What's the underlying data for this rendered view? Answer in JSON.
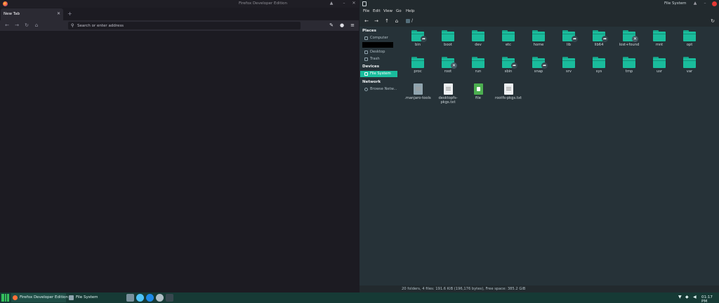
{
  "firefox": {
    "title": "Firefox Developer Edition",
    "tab_label": "New Tab",
    "new_tab_glyph": "+",
    "url_placeholder": "Search or enter address",
    "icons": [
      "back-icon",
      "forward-icon",
      "reload-icon",
      "home-icon",
      "search-icon",
      "wrench-icon",
      "account-icon",
      "menu-icon"
    ],
    "accent": "#ff7139"
  },
  "filemanager": {
    "title": "File System",
    "menu": [
      "File",
      "Edit",
      "View",
      "Go",
      "Help"
    ],
    "location": "/",
    "sidebar": {
      "places_heading": "Places",
      "places": [
        "Computer",
        "Desktop",
        "Trash"
      ],
      "devices_heading": "Devices",
      "devices": [
        "File System"
      ],
      "network_heading": "Network",
      "network": [
        "Browse Netw..."
      ]
    },
    "items": [
      {
        "name": "bin",
        "type": "folder",
        "emblem": "link"
      },
      {
        "name": "boot",
        "type": "folder",
        "emblem": ""
      },
      {
        "name": "dev",
        "type": "folder",
        "emblem": ""
      },
      {
        "name": "etc",
        "type": "folder",
        "emblem": ""
      },
      {
        "name": "home",
        "type": "folder",
        "emblem": ""
      },
      {
        "name": "lib",
        "type": "folder",
        "emblem": "link"
      },
      {
        "name": "lib64",
        "type": "folder",
        "emblem": "link"
      },
      {
        "name": "lost+found",
        "type": "folder",
        "emblem": "locked"
      },
      {
        "name": "mnt",
        "type": "folder",
        "emblem": ""
      },
      {
        "name": "opt",
        "type": "folder",
        "emblem": ""
      },
      {
        "name": "proc",
        "type": "folder",
        "emblem": ""
      },
      {
        "name": "root",
        "type": "folder",
        "emblem": "locked"
      },
      {
        "name": "run",
        "type": "folder",
        "emblem": ""
      },
      {
        "name": "sbin",
        "type": "folder",
        "emblem": "link"
      },
      {
        "name": "snap",
        "type": "folder",
        "emblem": "link"
      },
      {
        "name": "srv",
        "type": "folder",
        "emblem": ""
      },
      {
        "name": "sys",
        "type": "folder",
        "emblem": ""
      },
      {
        "name": "tmp",
        "type": "folder",
        "emblem": ""
      },
      {
        "name": "usr",
        "type": "folder",
        "emblem": ""
      },
      {
        "name": "var",
        "type": "folder",
        "emblem": ""
      },
      {
        "name": ".manjaro-tools",
        "type": "file-gray",
        "emblem": ""
      },
      {
        "name": "desktopfs-pkgs.txt",
        "type": "file-text",
        "emblem": ""
      },
      {
        "name": "file",
        "type": "file-green",
        "emblem": ""
      },
      {
        "name": "rootfs-pkgs.txt",
        "type": "file-text",
        "emblem": ""
      }
    ],
    "status": "20 folders, 4 files: 191.6 KiB (196,176 bytes), Free space: 385.2 GiB",
    "accent": "#1abc9c"
  },
  "taskbar": {
    "tasks": [
      "Firefox Developer Edition",
      "File System"
    ],
    "clock": "01:17 PM",
    "accent": "#35bf5c"
  }
}
